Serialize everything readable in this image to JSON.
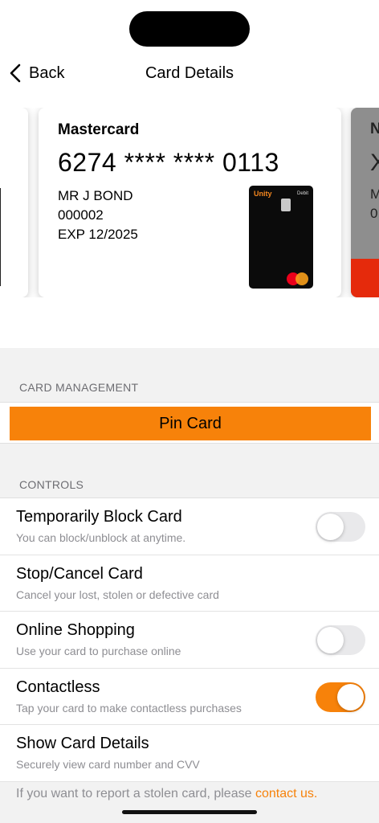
{
  "nav": {
    "back_label": "Back",
    "title": "Card Details"
  },
  "cards": {
    "main": {
      "brand": "Mastercard",
      "number": "6274 **** **** 0113",
      "holder": "MR J BOND",
      "account": "000002",
      "expiry": "EXP 12/2025",
      "image": {
        "logo": "Unity",
        "type": "Debit"
      }
    },
    "next_peek": {
      "l1": "N",
      "l2": "X",
      "l3": "M",
      "l4": "0"
    }
  },
  "sections": {
    "management": "CARD MANAGEMENT",
    "controls": "CONTROLS"
  },
  "pin_button": "Pin Card",
  "controls": [
    {
      "title": "Temporarily Block Card",
      "subtitle": "You can block/unblock at anytime.",
      "toggle": false
    },
    {
      "title": "Stop/Cancel Card",
      "subtitle": "Cancel your lost, stolen or defective card"
    },
    {
      "title": "Online Shopping",
      "subtitle": "Use your card to purchase online",
      "toggle": false
    },
    {
      "title": "Contactless",
      "subtitle": "Tap your card to make contactless purchases",
      "toggle": true
    },
    {
      "title": "Show Card Details",
      "subtitle": "Securely view card number and CVV"
    }
  ],
  "footer": {
    "text": "If you want to report a stolen card, please ",
    "link": "contact us."
  },
  "colors": {
    "accent": "#f7820a",
    "card_strip": "#e52a0c"
  }
}
